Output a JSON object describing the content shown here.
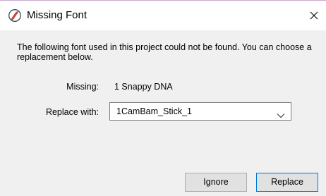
{
  "window": {
    "title": "Missing Font",
    "icon": "app-icon",
    "close_icon": "close-icon"
  },
  "message": "The following font used in this project could not be found. You can choose a replacement below.",
  "missing": {
    "label": "Missing:",
    "value": "1 Snappy DNA"
  },
  "replace": {
    "label": "Replace with:",
    "selected": "1CamBam_Stick_1",
    "arrow_icon": "chevron-down-icon"
  },
  "buttons": {
    "ignore": "Ignore",
    "replace": "Replace"
  },
  "colors": {
    "dialog_bg": "#f0f0f0",
    "titlebar_bg": "#ffffff",
    "default_button_border": "#0078d7"
  }
}
